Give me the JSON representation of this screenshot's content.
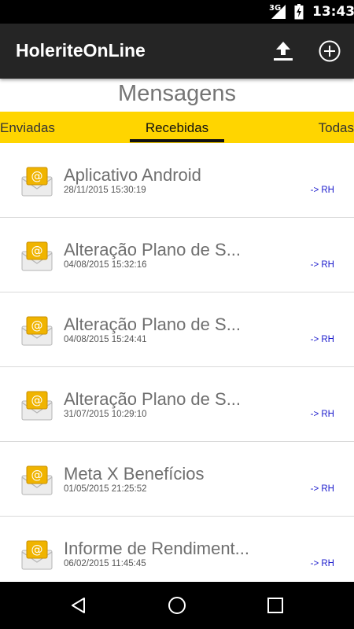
{
  "status_bar": {
    "network": "3G",
    "time": "13:43"
  },
  "app_bar": {
    "title": "HoleriteOnLine",
    "upload_icon": "upload-icon",
    "add_icon": "add-circle-icon"
  },
  "page": {
    "title": "Mensagens"
  },
  "tabs": {
    "items": [
      {
        "label": "Enviadas"
      },
      {
        "label": "Recebidas"
      },
      {
        "label": "Todas"
      }
    ],
    "selected": "Recebidas"
  },
  "messages": [
    {
      "subject": "Aplicativo Android",
      "date": "28/11/2015 15:30:19",
      "sender": "-> RH"
    },
    {
      "subject": "Alteração Plano de S...",
      "date": "04/08/2015 15:32:16",
      "sender": "-> RH"
    },
    {
      "subject": "Alteração Plano de S...",
      "date": "04/08/2015 15:24:41",
      "sender": "-> RH"
    },
    {
      "subject": "Alteração Plano de S...",
      "date": "31/07/2015 10:29:10",
      "sender": "-> RH"
    },
    {
      "subject": "Meta X Benefícios",
      "date": "01/05/2015 21:25:52",
      "sender": "-> RH"
    },
    {
      "subject": "Informe de Rendiment...",
      "date": "06/02/2015 11:45:45",
      "sender": "-> RH"
    }
  ],
  "colors": {
    "accent": "#FFD500",
    "app_bar": "#252525",
    "sender_link": "#1a1acc"
  },
  "nav_bar": {
    "icons": [
      "back-icon",
      "home-icon",
      "recents-icon"
    ]
  }
}
